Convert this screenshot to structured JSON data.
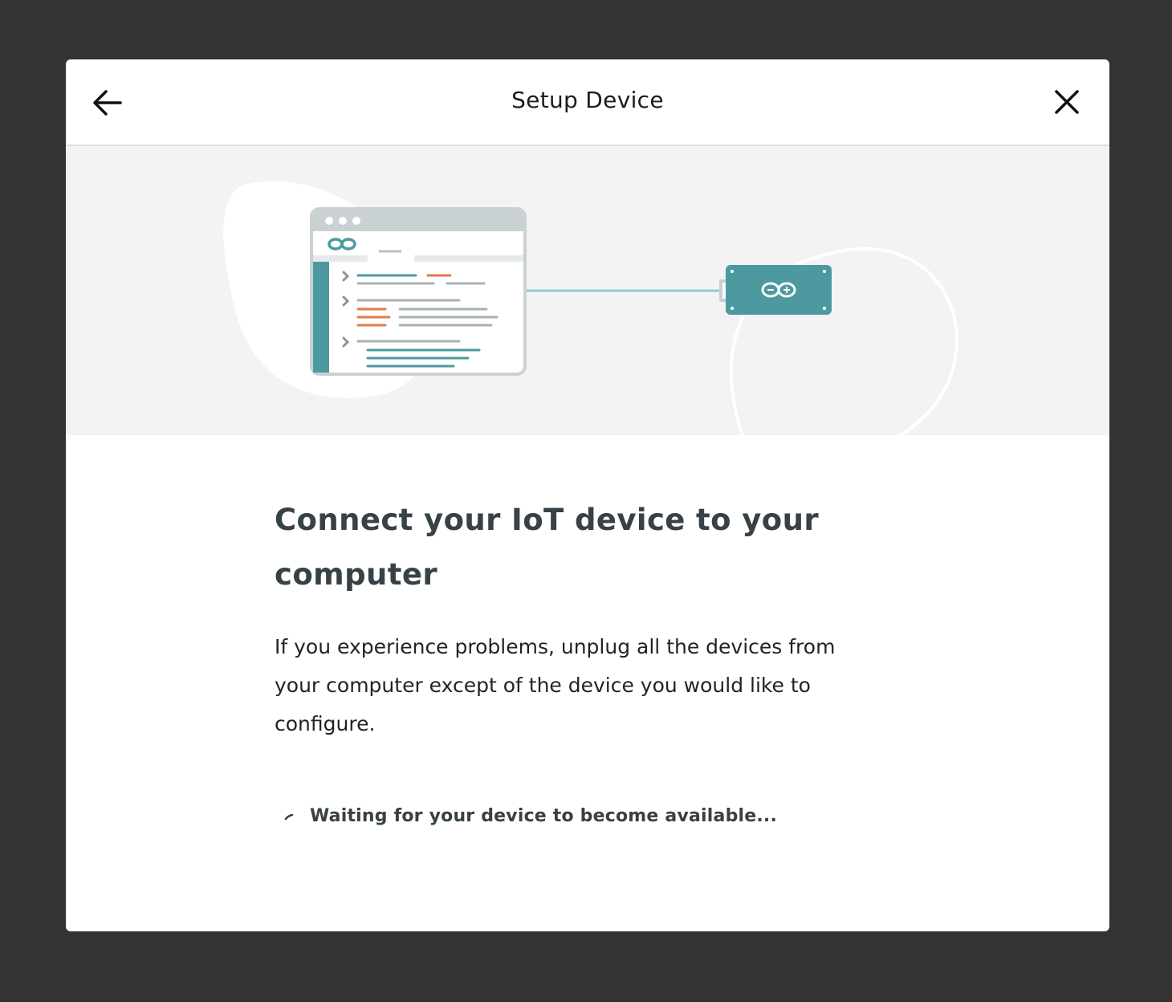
{
  "dialog": {
    "title": "Setup Device",
    "back_icon": "arrow-left-icon",
    "close_icon": "close-icon"
  },
  "hero": {
    "illustration": "computer-connected-to-arduino-device",
    "colors": {
      "teal": "#4c9a9f",
      "orange": "#e07b4f",
      "cable": "#8fcbcd",
      "window_frame": "#c9d1d2"
    }
  },
  "main": {
    "heading": "Connect your IoT device to your computer",
    "body": "If you experience problems, unplug all the devices from your computer except of the device you would like to configure.",
    "status": "Waiting for your device to become available..."
  }
}
